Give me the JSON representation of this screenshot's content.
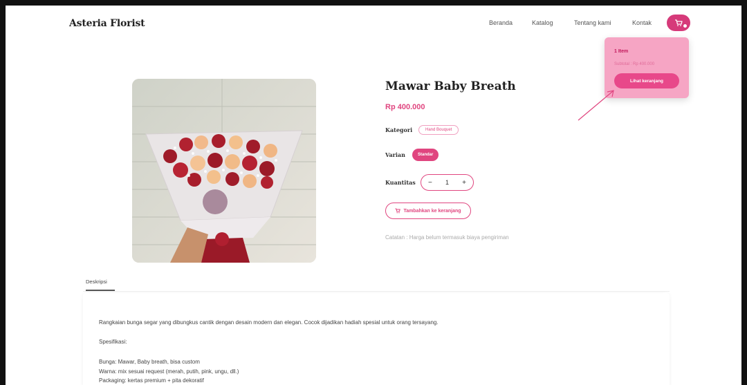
{
  "header": {
    "brand": "Asteria Florist",
    "nav": [
      "Beranda",
      "Katalog",
      "Tentang kami",
      "Kontak"
    ]
  },
  "cart_popup": {
    "items_count": "1 Item",
    "subtotal": "Subtotal : Rp 400.000",
    "view_cart_label": "Lihat keranjang"
  },
  "product": {
    "title": "Mawar Baby Breath",
    "price": "Rp 400.000",
    "category_label": "Kategori",
    "category_value": "Hand Bouquet",
    "variant_label": "Varian",
    "variant_value": "Standar",
    "quantity_label": "Kuantitas",
    "quantity_value": "1",
    "minus": "−",
    "plus": "+",
    "add_to_cart_label": "Tambahkan ke keranjang",
    "note": "Catatan : Harga belum termasuk biaya pengiriman"
  },
  "tabs": {
    "description_tab": "Deskripsi"
  },
  "description": {
    "intro": "Rangkaian bunga segar yang dibungkus cantik dengan desain modern dan elegan. Cocok dijadikan hadiah spesial untuk orang tersayang.",
    "spec_heading": "Spesifikasi:",
    "spec_lines": [
      "Bunga: Mawar, Baby breath, bisa custom",
      "Warna: mix sesuai request (merah, putih, pink, ungu, dll.)",
      "Packaging: kertas premium + pita dekoratif"
    ]
  },
  "colors": {
    "accent": "#e0457f",
    "popup_bg": "#f6a5c4",
    "cart_button": "#d63a7a"
  }
}
